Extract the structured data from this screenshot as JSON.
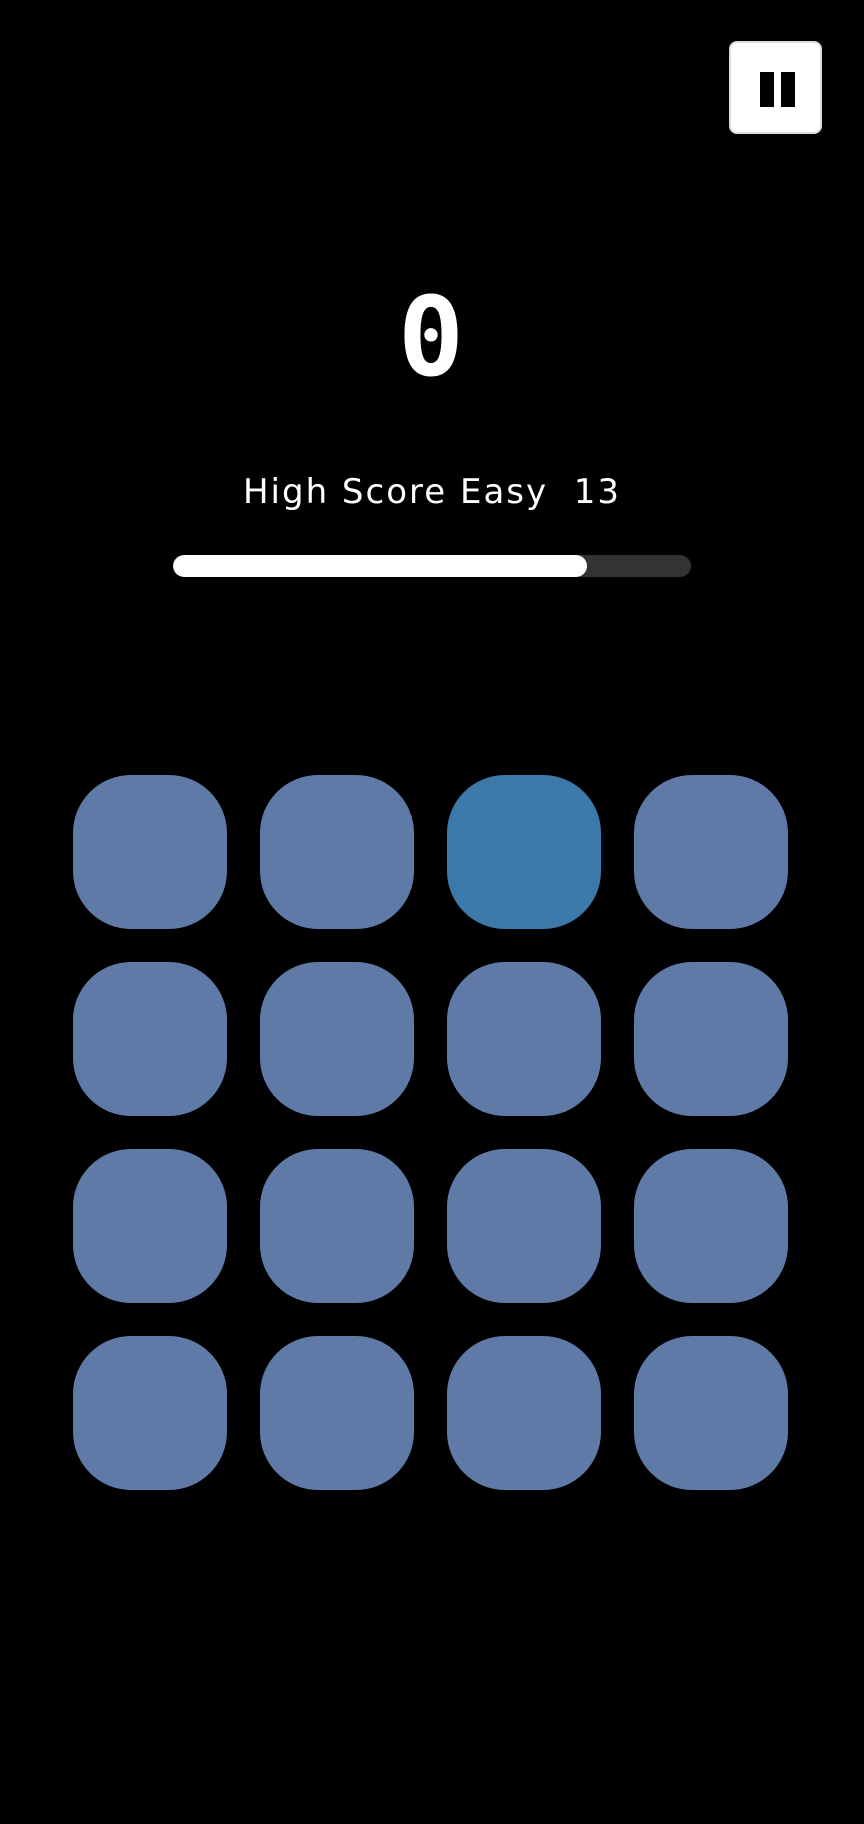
{
  "game": {
    "score": "0",
    "high_score_label": "High Score Easy",
    "high_score_value": "13",
    "timer_progress": 0.8
  },
  "controls": {
    "pause_icon": "pause-icon"
  },
  "colors": {
    "background": "#000000",
    "tile": "#5f7aa6",
    "tile_highlight": "#3c78a8",
    "progress_fill": "#ffffff",
    "progress_track": "#333333"
  },
  "grid": {
    "rows": 4,
    "cols": 4,
    "active_tiles": [
      {
        "row": 1,
        "col": 3
      }
    ]
  }
}
